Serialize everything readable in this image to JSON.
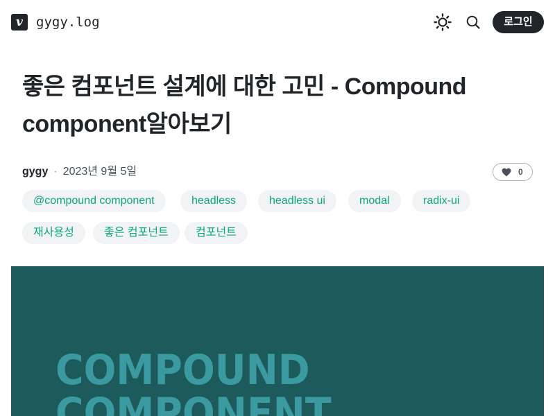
{
  "header": {
    "logo_letter": "v",
    "blog_name": "gygy.log",
    "theme_icon": "sun-icon",
    "search_icon": "search-icon",
    "login_label": "로그인"
  },
  "post": {
    "title_line1": "좋은 컴포넌트 설계에 대한 고민 - Compound",
    "title_line2": "component알아보기",
    "author": "gygy",
    "separator": "·",
    "date": "2023년 9월 5일",
    "like_icon": "heart-icon",
    "like_count": "0",
    "tags": [
      "@compound component",
      "headless",
      "headless ui",
      "modal",
      "radix-ui",
      "재사용성",
      "좋은 컴포넌트",
      "컴포넌트"
    ]
  },
  "hero": {
    "line1": "COMPOUND",
    "line2": "COMPONENT"
  },
  "colors": {
    "text": "#212529",
    "tag_text": "#0ca678",
    "tag_bg": "#f1f3f5",
    "hero_bg": "#1d5a5c",
    "hero_text": "#3a9aa0",
    "dark_button": "#212529"
  }
}
